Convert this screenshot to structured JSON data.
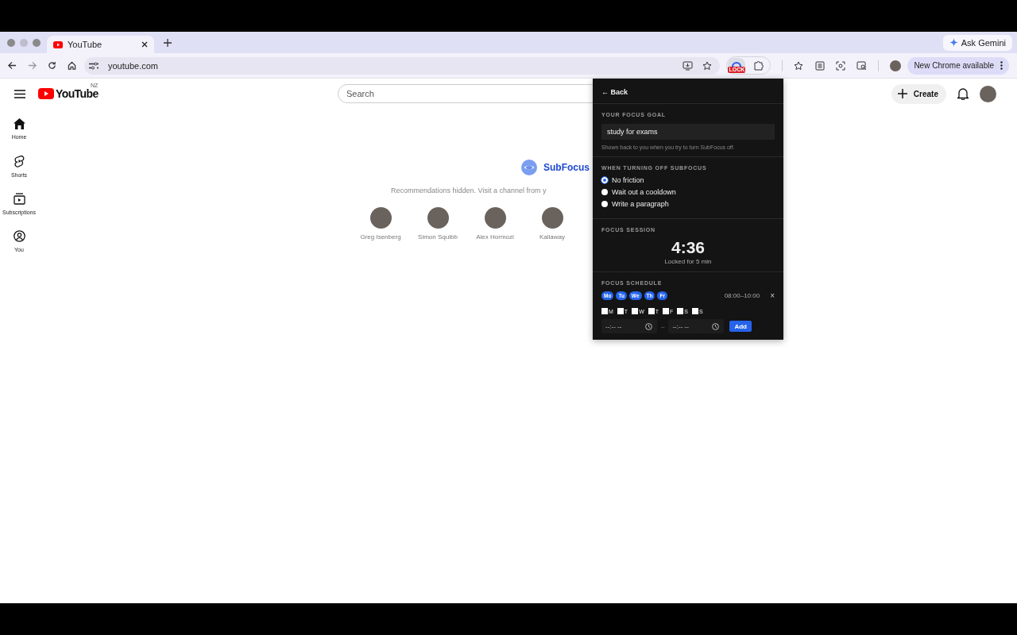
{
  "browser": {
    "tabs": [
      {
        "title": "YouTube",
        "selected": true
      }
    ],
    "ask_gemini": "Ask Gemini",
    "url": "youtube.com",
    "update_button": "New Chrome available",
    "extension_badge": "LOCK"
  },
  "youtube": {
    "wordmark": "YouTube",
    "region": "NZ",
    "search": {
      "placeholder": "Search"
    },
    "create": "Create",
    "sidebar": [
      {
        "label": "Home",
        "kind": "home"
      },
      {
        "label": "Shorts",
        "kind": "shorts"
      },
      {
        "label": "Subscriptions",
        "kind": "subscriptions"
      },
      {
        "label": "You",
        "kind": "you"
      }
    ],
    "brand": "SubFocus",
    "message": "Recommendations hidden. Visit a channel from y",
    "channels": [
      {
        "name": "Greg Isenberg"
      },
      {
        "name": "Simon Squibb"
      },
      {
        "name": "Alex Hormozi"
      },
      {
        "name": "Kallaway"
      }
    ]
  },
  "popup": {
    "back": "← Back",
    "goal_heading": "YOUR FOCUS GOAL",
    "goal_value": "study for exams",
    "goal_hint": "Shown back to you when you try to turn SubFocus off.",
    "off_heading": "WHEN TURNING OFF SUBFOCUS",
    "off_options": [
      {
        "label": "No friction",
        "selected": true
      },
      {
        "label": "Wait out a cooldown",
        "selected": false
      },
      {
        "label": "Write a paragraph",
        "selected": false
      }
    ],
    "session_heading": "FOCUS SESSION",
    "timer": "4:36",
    "timer_note": "Locked for 5 min",
    "schedule_heading": "FOCUS SCHEDULE",
    "schedules": [
      {
        "days": [
          "Mo",
          "Tu",
          "We",
          "Th",
          "Fr"
        ],
        "time": "08:00–10:00",
        "remove": "×"
      }
    ],
    "day_checks": [
      {
        "label": "M",
        "checked": false
      },
      {
        "label": "T",
        "checked": false
      },
      {
        "label": "W",
        "checked": false
      },
      {
        "label": "T",
        "checked": false
      },
      {
        "label": "F",
        "checked": false
      },
      {
        "label": "S",
        "checked": false
      },
      {
        "label": "S",
        "checked": false
      }
    ],
    "start_time": {
      "placeholder": "--:-- --"
    },
    "dash": "–",
    "end_time": {
      "placeholder": "--:-- --"
    },
    "add": "Add"
  }
}
